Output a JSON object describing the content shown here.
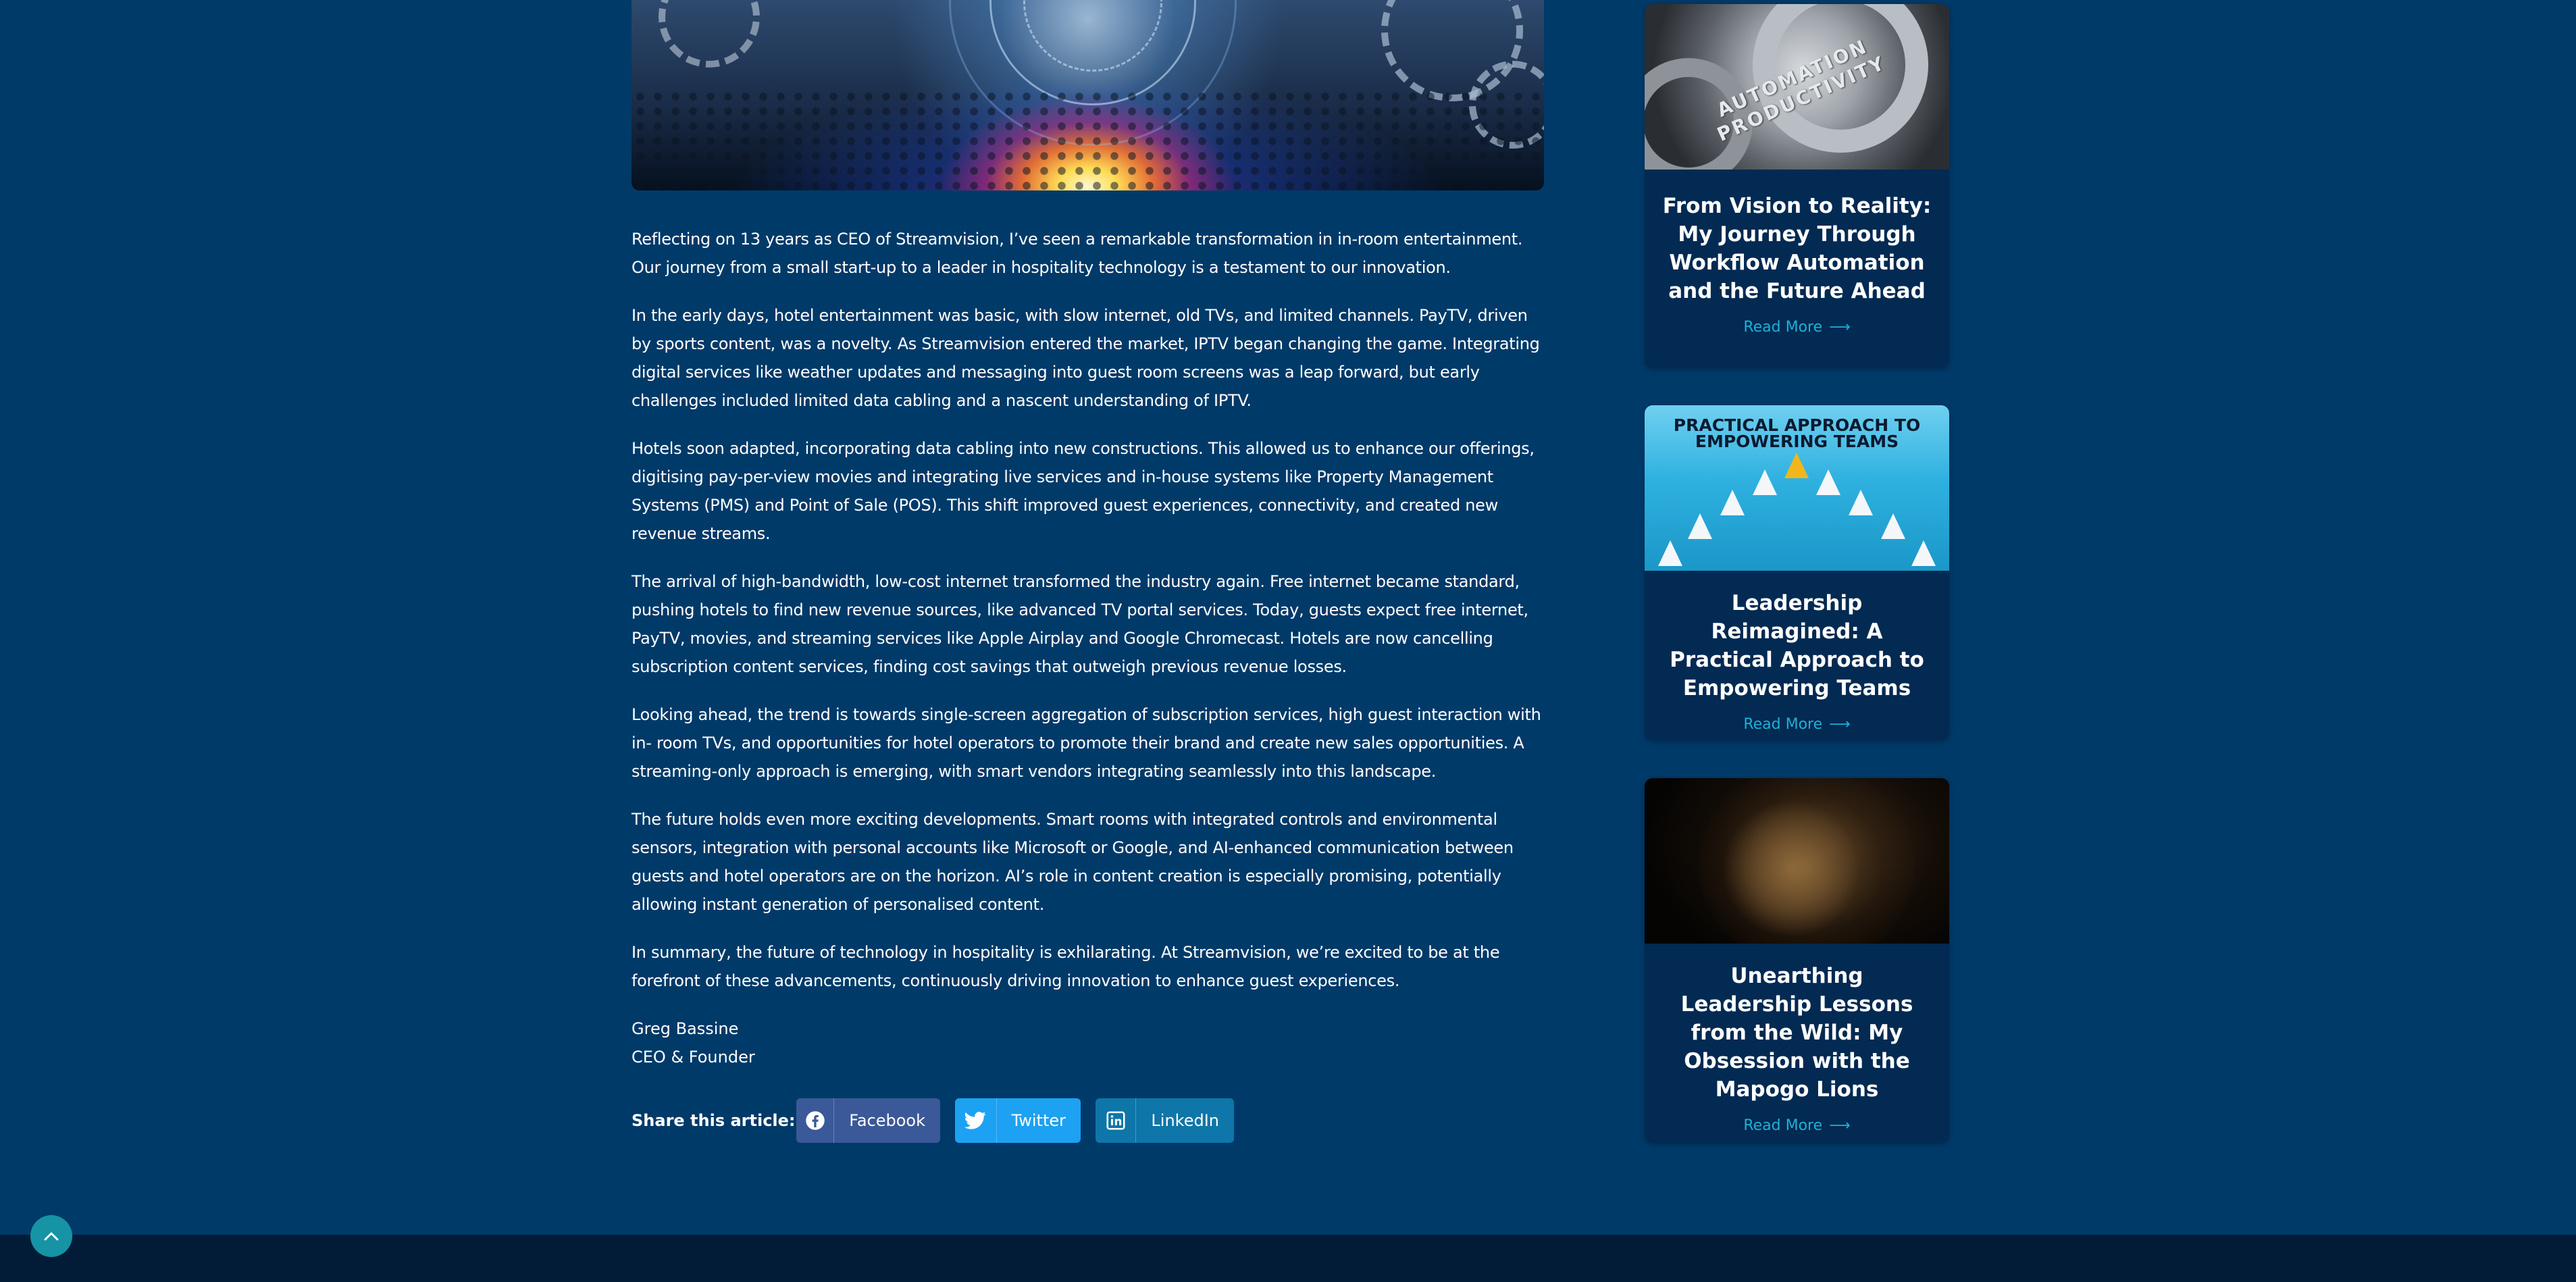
{
  "article": {
    "paragraphs": [
      "Reflecting on 13 years as CEO of Streamvision, I’ve seen a remarkable transformation in in-room entertainment. Our journey from a small start-up to a leader in hospitality technology is a testament to our innovation.",
      "In the early days, hotel entertainment was basic, with slow internet, old TVs, and limited channels. PayTV, driven by sports content, was a novelty. As Streamvision entered the market, IPTV began changing the game. Integrating digital services like weather updates and messaging into guest room screens was a leap forward, but early challenges included limited data cabling and a nascent understanding of IPTV.",
      "Hotels soon adapted, incorporating data cabling into new constructions. This allowed us to enhance our offerings, digitising pay-per-view movies and integrating live services and in-house systems like Property Management Systems (PMS) and Point of Sale (POS). This shift improved guest experiences, connectivity, and created new revenue streams.",
      "The arrival of high-bandwidth, low-cost internet transformed the industry again. Free internet became standard, pushing hotels to find new revenue sources, like advanced TV portal services. Today, guests expect free internet, PayTV, movies, and streaming services like Apple Airplay and Google Chromecast. Hotels are now cancelling subscription content services, finding cost savings that outweigh previous revenue losses.",
      "Looking ahead, the trend is towards single-screen aggregation of subscription services, high guest interaction with in- room TVs, and opportunities for hotel operators to promote their brand and create new sales opportunities. A streaming-only approach is emerging, with smart vendors integrating seamlessly into this landscape.",
      "The future holds even more exciting developments. Smart rooms with integrated controls and environmental sensors, integration with personal accounts like Microsoft or Google, and AI-enhanced communication between guests and hotel operators are on the horizon. AI’s role in content creation is especially promising, potentially allowing instant generation of personalised content.",
      "In summary, the future of technology in hospitality is exhilarating. At Streamvision, we’re excited to be at the forefront of these advancements, continuously driving innovation to enhance guest experiences."
    ],
    "author_name": "Greg Bassine",
    "author_title": "CEO & Founder"
  },
  "share": {
    "label": "Share this article:",
    "buttons": [
      {
        "label": "Facebook",
        "icon": "facebook-icon",
        "color": "#3b5998"
      },
      {
        "label": "Twitter",
        "icon": "twitter-icon",
        "color": "#1da1f2"
      },
      {
        "label": "LinkedIn",
        "icon": "linkedin-icon",
        "color": "#0e76a8"
      }
    ]
  },
  "sidebar": {
    "cards": [
      {
        "title": "From Vision to Reality: My Journey Through Workflow Automation and the Future Ahead",
        "read_more": "Read More",
        "image_text": "AUTOMATION PRODUCTIVITY"
      },
      {
        "title": "Leadership Reimagined: A Practical Approach to Empowering Teams",
        "read_more": "Read More",
        "image_text": "PRACTICAL APPROACH TO EMPOWERING TEAMS"
      },
      {
        "title": "Unearthing Leadership Lessons from the Wild: My Obsession with the Mapogo Lions",
        "read_more": "Read More",
        "image_text": ""
      }
    ]
  },
  "colors": {
    "background": "#003a69",
    "card_background": "#022a52",
    "accent": "#1fb0d8",
    "footer": "#021c38",
    "back_to_top": "#1693a5"
  },
  "icons": {
    "back_to_top": "chevron-up-icon",
    "read_more": "arrow-right-icon"
  }
}
